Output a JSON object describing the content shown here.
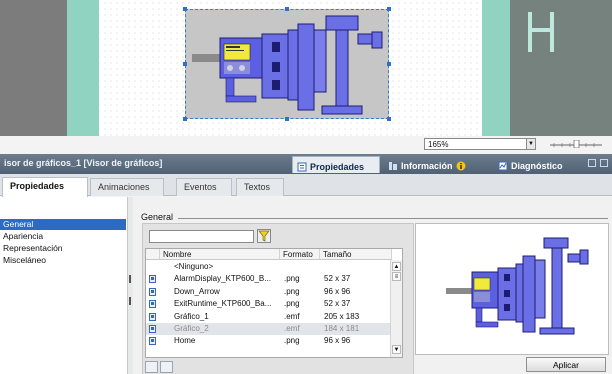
{
  "canvas": {
    "zoom_value": "165%",
    "zoom_options": [
      "165%"
    ]
  },
  "window": {
    "title": "isor de gráficos_1 [Visor de gráficos]",
    "tabs": [
      {
        "label": "Propiedades",
        "icon": "properties-icon"
      },
      {
        "label": "Información",
        "icon": "info-icon"
      },
      {
        "label": "Diagnóstico",
        "icon": "diagnostics-icon"
      }
    ]
  },
  "subtabs": [
    "Propiedades",
    "Animaciones",
    "Eventos",
    "Textos"
  ],
  "nav": {
    "items": [
      "General",
      "Apariencia",
      "Representación",
      "Misceláneo"
    ],
    "selected": "General"
  },
  "section": {
    "title": "General",
    "filter_value": "",
    "table": {
      "columns": [
        "Nombre",
        "Formato",
        "Tamaño"
      ],
      "rows": [
        {
          "name": "<Ninguno>",
          "format": "",
          "size": ""
        },
        {
          "name": "AlarmDisplay_KTP600_B...",
          "format": ".png",
          "size": "52 x 37"
        },
        {
          "name": "Down_Arrow",
          "format": ".png",
          "size": "96 x 96"
        },
        {
          "name": "ExitRuntime_KTP600_Ba...",
          "format": ".png",
          "size": "52 x 37"
        },
        {
          "name": "Gráfico_1",
          "format": ".emf",
          "size": "205 x 183"
        },
        {
          "name": "Gráfico_2",
          "format": ".emf",
          "size": "184 x 181"
        },
        {
          "name": "Home",
          "format": ".png",
          "size": "96 x 96"
        }
      ],
      "selected_row": "Gráfico_2"
    },
    "apply_label": "Aplicar"
  },
  "colors": {
    "accent": "#2a6bc3",
    "pump_blue": "#6b6fe6",
    "panel_teal": "#8fd3c0",
    "titlebar": "#566779"
  }
}
